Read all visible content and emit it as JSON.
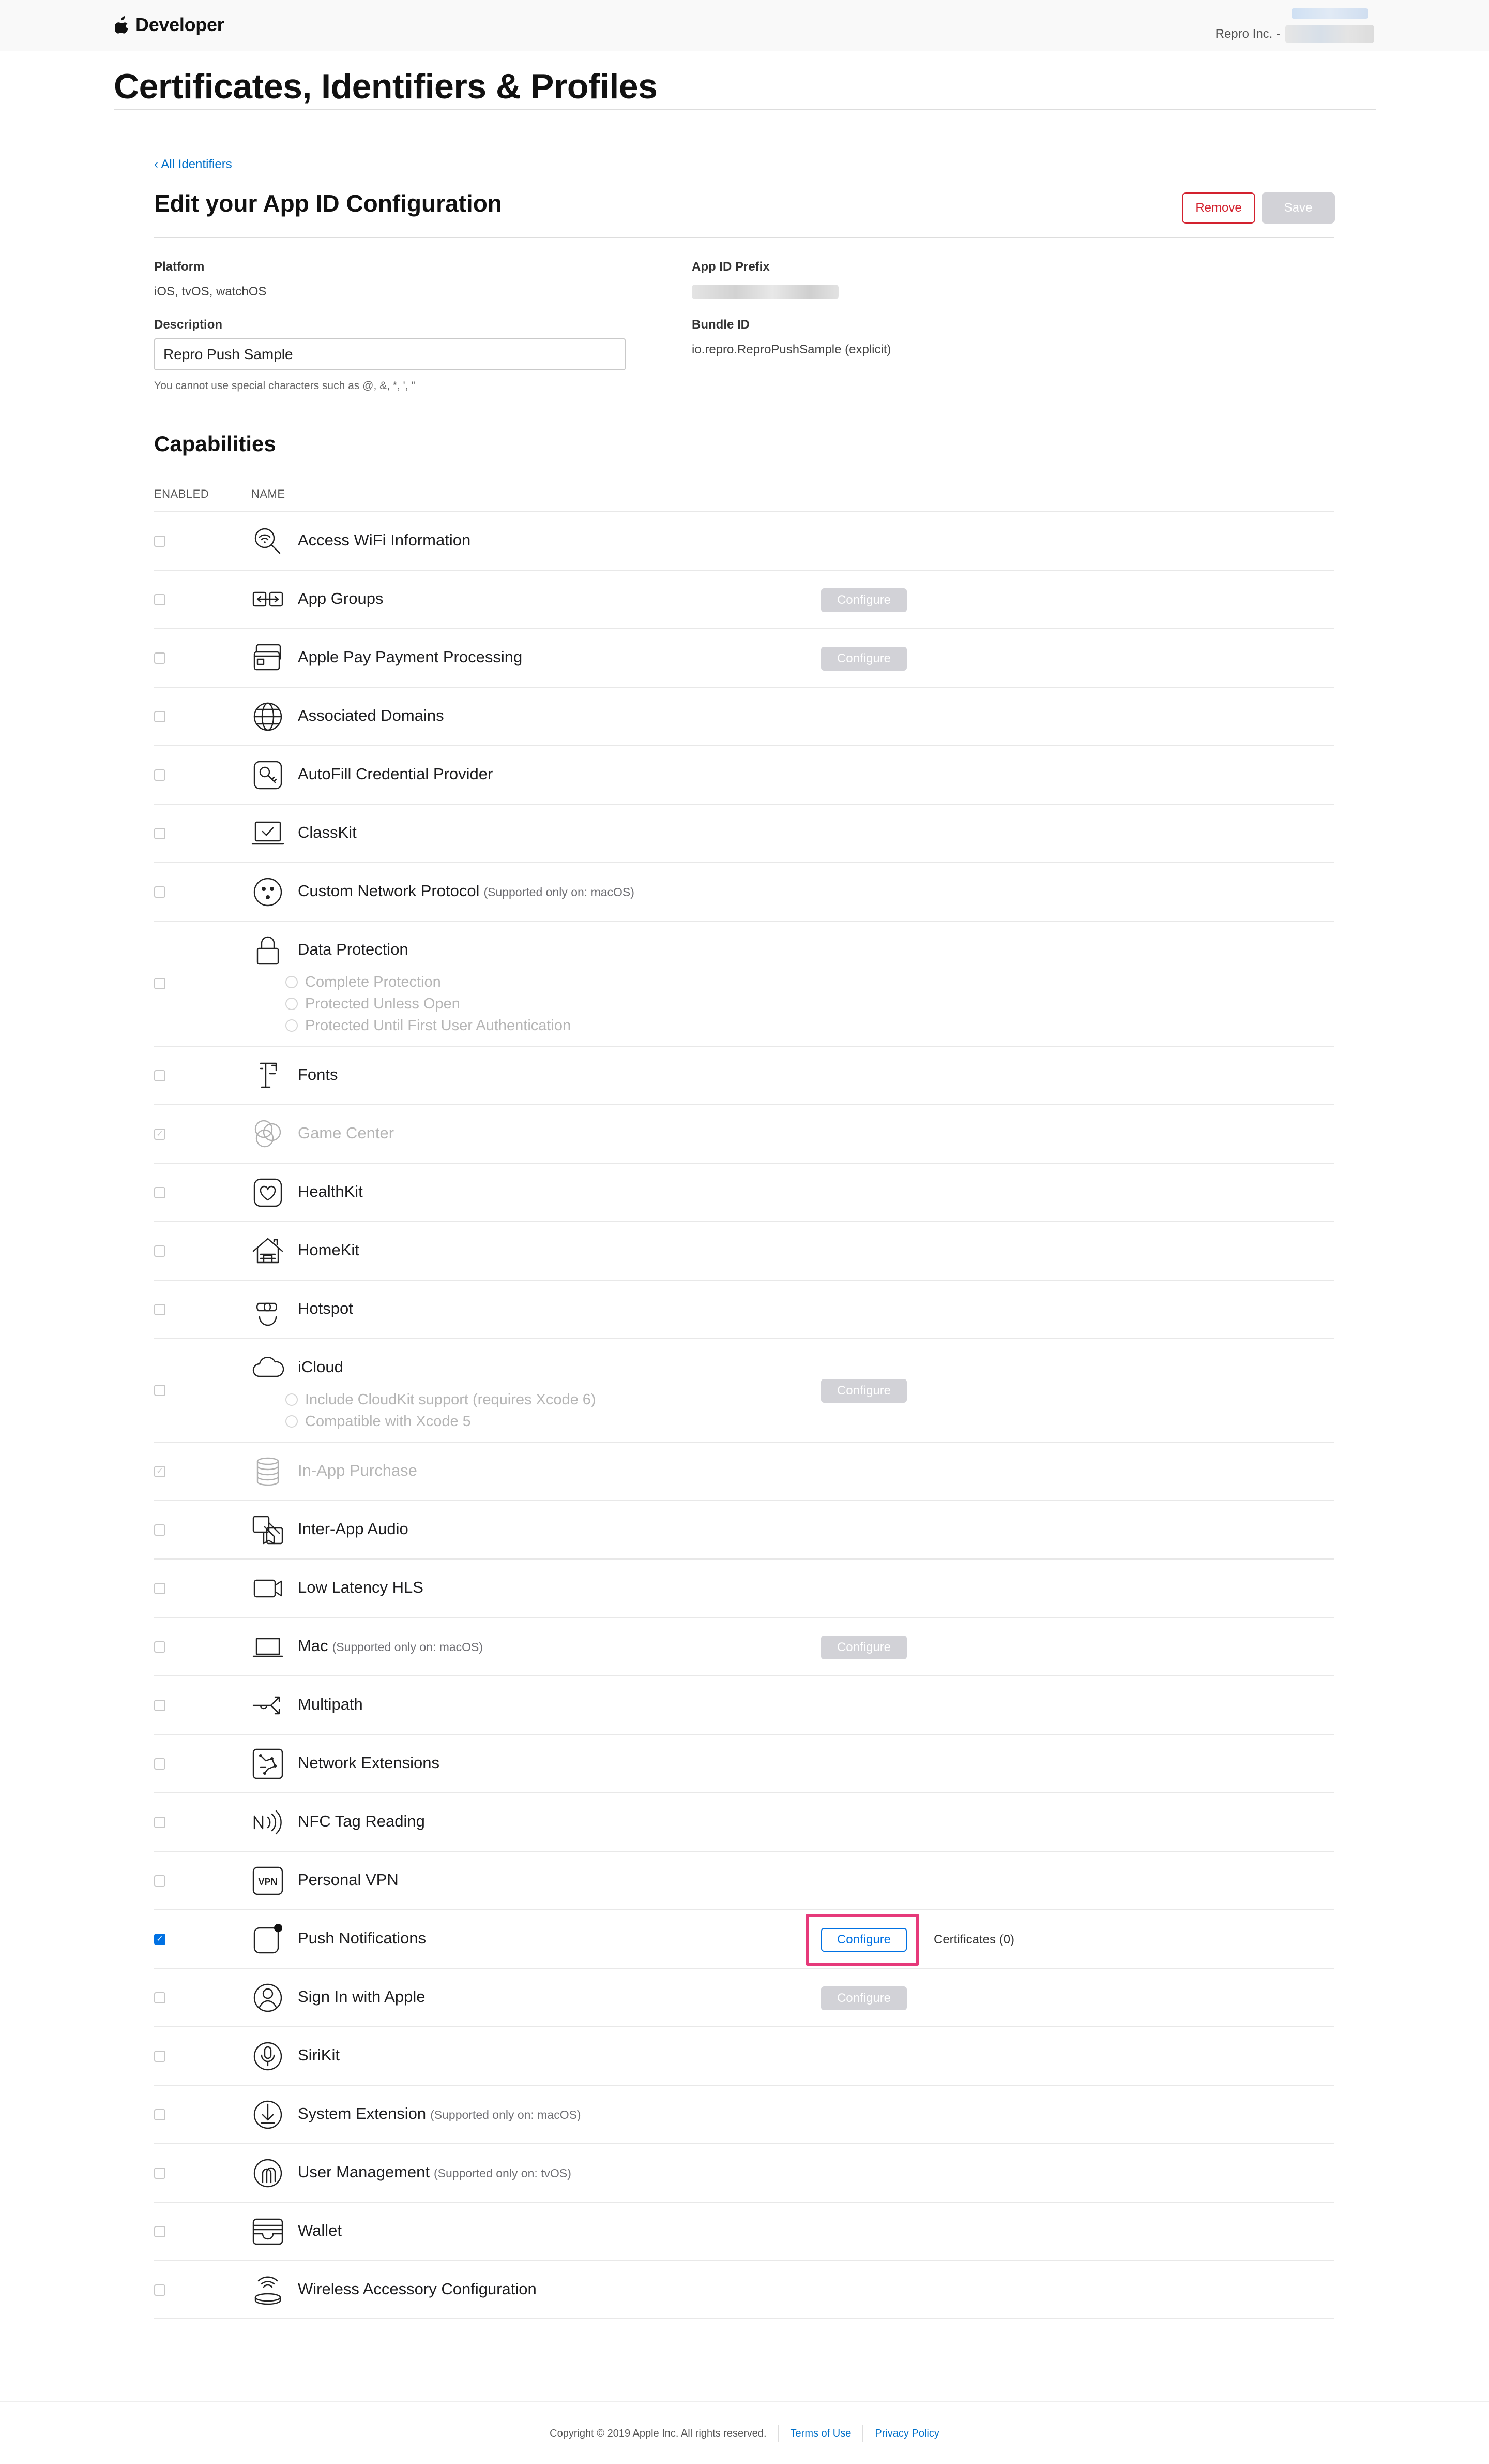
{
  "nav": {
    "brand": "Developer",
    "account_name": "Repro Inc. -"
  },
  "page_title": "Certificates, Identifiers & Profiles",
  "back_link": "All Identifiers",
  "section_title": "Edit your App ID Configuration",
  "actions": {
    "remove_label": "Remove",
    "save_label": "Save"
  },
  "form": {
    "platform_label": "Platform",
    "platform_value": "iOS, tvOS, watchOS",
    "description_label": "Description",
    "description_value": "Repro Push Sample",
    "description_hint": "You cannot use special characters such as @, &, *, ', \"",
    "prefix_label": "App ID Prefix",
    "bundle_label": "Bundle ID",
    "bundle_value": "io.repro.ReproPushSample (explicit)"
  },
  "capabilities": {
    "title": "Capabilities",
    "col_enabled": "ENABLED",
    "col_name": "NAME",
    "configure_label": "Configure",
    "items": [
      {
        "name": "Access WiFi Information",
        "icon": "wifi-search-icon",
        "enabled": false
      },
      {
        "name": "App Groups",
        "icon": "app-groups-icon",
        "enabled": false,
        "configure": "disabled"
      },
      {
        "name": "Apple Pay Payment Processing",
        "icon": "apple-pay-icon",
        "enabled": false,
        "configure": "disabled"
      },
      {
        "name": "Associated Domains",
        "icon": "globe-icon",
        "enabled": false
      },
      {
        "name": "AutoFill Credential Provider",
        "icon": "key-icon",
        "enabled": false
      },
      {
        "name": "ClassKit",
        "icon": "classkit-icon",
        "enabled": false
      },
      {
        "name": "Custom Network Protocol",
        "note": "(Supported only on: macOS)",
        "icon": "network-protocol-icon",
        "enabled": false
      },
      {
        "name": "Data Protection",
        "icon": "lock-icon",
        "enabled": false,
        "options": [
          "Complete Protection",
          "Protected Unless Open",
          "Protected Until First User Authentication"
        ]
      },
      {
        "name": "Fonts",
        "icon": "fonts-icon",
        "enabled": false
      },
      {
        "name": "Game Center",
        "icon": "game-center-icon",
        "enabled": true,
        "disabled": true
      },
      {
        "name": "HealthKit",
        "icon": "heart-icon",
        "enabled": false
      },
      {
        "name": "HomeKit",
        "icon": "home-icon",
        "enabled": false
      },
      {
        "name": "Hotspot",
        "icon": "hotspot-icon",
        "enabled": false
      },
      {
        "name": "iCloud",
        "icon": "cloud-icon",
        "enabled": false,
        "configure": "disabled",
        "options": [
          "Include CloudKit support (requires Xcode 6)",
          "Compatible with Xcode 5"
        ]
      },
      {
        "name": "In-App Purchase",
        "icon": "coins-icon",
        "enabled": true,
        "disabled": true
      },
      {
        "name": "Inter-App Audio",
        "icon": "inter-app-audio-icon",
        "enabled": false
      },
      {
        "name": "Low Latency HLS",
        "icon": "camera-icon",
        "enabled": false
      },
      {
        "name": "Mac",
        "note": "(Supported only on: macOS)",
        "icon": "laptop-icon",
        "enabled": false,
        "configure": "disabled"
      },
      {
        "name": "Multipath",
        "icon": "multipath-icon",
        "enabled": false
      },
      {
        "name": "Network Extensions",
        "icon": "network-extensions-icon",
        "enabled": false
      },
      {
        "name": "NFC Tag Reading",
        "icon": "nfc-icon",
        "enabled": false
      },
      {
        "name": "Personal VPN",
        "icon": "vpn-icon",
        "enabled": false
      },
      {
        "name": "Push Notifications",
        "icon": "push-notification-icon",
        "enabled": true,
        "configure": "active",
        "certificates": "Certificates (0)"
      },
      {
        "name": "Sign In with Apple",
        "icon": "sign-in-apple-icon",
        "enabled": false,
        "configure": "disabled"
      },
      {
        "name": "SiriKit",
        "icon": "siri-mic-icon",
        "enabled": false
      },
      {
        "name": "System Extension",
        "note": "(Supported only on: macOS)",
        "icon": "system-extension-icon",
        "enabled": false
      },
      {
        "name": "User Management",
        "note": "(Supported only on: tvOS)",
        "icon": "users-icon",
        "enabled": false
      },
      {
        "name": "Wallet",
        "icon": "wallet-icon",
        "enabled": false
      },
      {
        "name": "Wireless Accessory Configuration",
        "icon": "wireless-accessory-icon",
        "enabled": false
      }
    ]
  },
  "footer": {
    "copyright": "Copyright © 2019 Apple Inc. All rights reserved.",
    "terms": "Terms of Use",
    "privacy": "Privacy Policy"
  },
  "colors": {
    "accent": "#0071e3",
    "link": "#0070c9",
    "danger": "#d3212e",
    "highlight": "#e6397a"
  }
}
